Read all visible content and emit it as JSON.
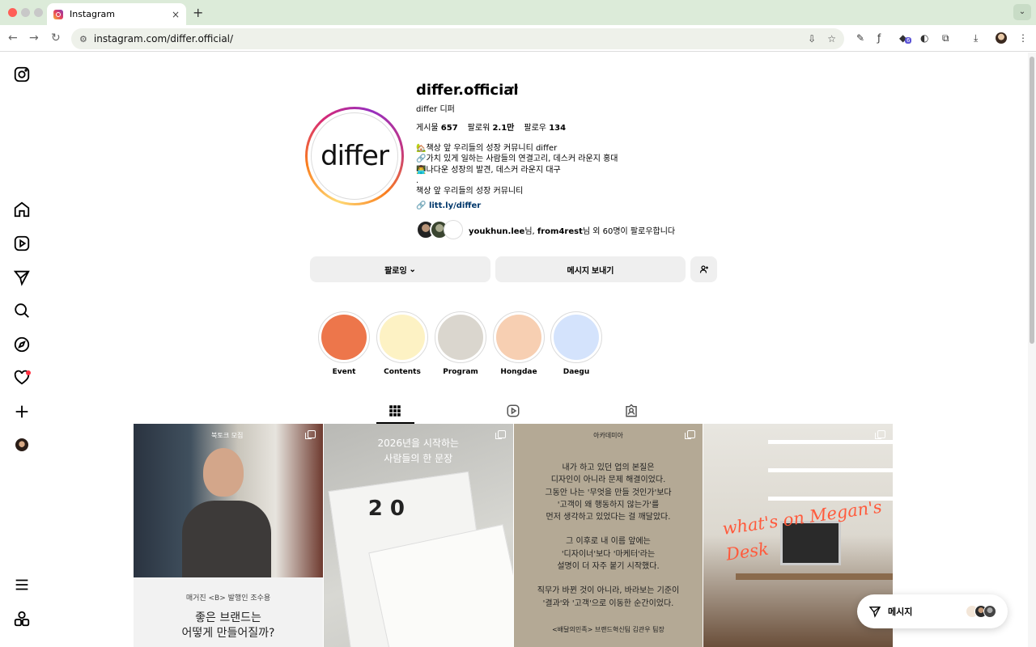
{
  "browser": {
    "tab_title": "Instagram",
    "tab_close": "×",
    "new_tab": "+",
    "url": "instagram.com/differ.official/",
    "extension_badge": "6"
  },
  "profile": {
    "username": "differ.official",
    "more": "···",
    "full_name": "differ 디퍼",
    "avatar_text": "differ",
    "stats": [
      {
        "label": "게시물",
        "value": "657"
      },
      {
        "label": "팔로워",
        "value": "2.1만"
      },
      {
        "label": "팔로우",
        "value": "134"
      }
    ],
    "bio": [
      "🏡책상 앞 우리들의 성장 커뮤니티 differ",
      "🔗가치 있게 일하는 사람들의 연결고리, 데스커 라운지 홍대",
      "👨‍💻나다운 성장의 발견, 데스커 라운지 대구",
      ".",
      "책상 앞 우리들의 성장 커뮤니티"
    ],
    "link": "litt.ly/differ",
    "followed_by_names": "youkhun.lee",
    "followed_by_mid": "님, ",
    "followed_by_names2": "from4rest",
    "followed_by_tail": "님 외 60명이 팔로우합니다"
  },
  "actions": {
    "follow_label": "팔로잉",
    "follow_chevron": "⌄",
    "message_label": "메시지 보내기"
  },
  "highlights": [
    {
      "label": "Event",
      "color": "#ed764b"
    },
    {
      "label": "Contents",
      "color": "#fdf2c4"
    },
    {
      "label": "Program",
      "color": "#dad6ce"
    },
    {
      "label": "Hongdae",
      "color": "#f7cfb2"
    },
    {
      "label": "Daegu",
      "color": "#d4e3fc"
    }
  ],
  "grid": {
    "post1": {
      "tag": "북토크 모집",
      "sub": "매거진 <B> 발행인 조수용",
      "title_line1": "좋은 브랜드는",
      "title_line2": "어떻게 만들어질까?"
    },
    "post2": {
      "title_line1": "2026년을 시작하는",
      "title_line2": "사람들의 한 문장",
      "mark": "2 0"
    },
    "post3": {
      "tag": "아카데미아",
      "lines": [
        "내가 하고 있던 업의 본질은",
        "디자인이 아니라 문제 해결이었다.",
        "그동안 나는 '무엇을 만들 것인가'보다",
        "'고객이 왜 행동하지 않는가'를",
        "먼저 생각하고 있었다는 걸 깨달았다.",
        "",
        "그 이후로 내 이름 앞에는",
        "'디자이너'보다 '마케터'라는",
        "설명이 더 자주 붙기 시작했다.",
        "",
        "직무가 바뀐 것이 아니라, 바라보는 기준이",
        "'결과'와 '고객'으로 이동한 순간이었다."
      ],
      "foot": "<배달의민족> 브랜드혁신팀 김관우 팀장"
    },
    "post4": {
      "script": "what's on Megan's Desk"
    }
  },
  "floating_message": {
    "label": "메시지"
  }
}
